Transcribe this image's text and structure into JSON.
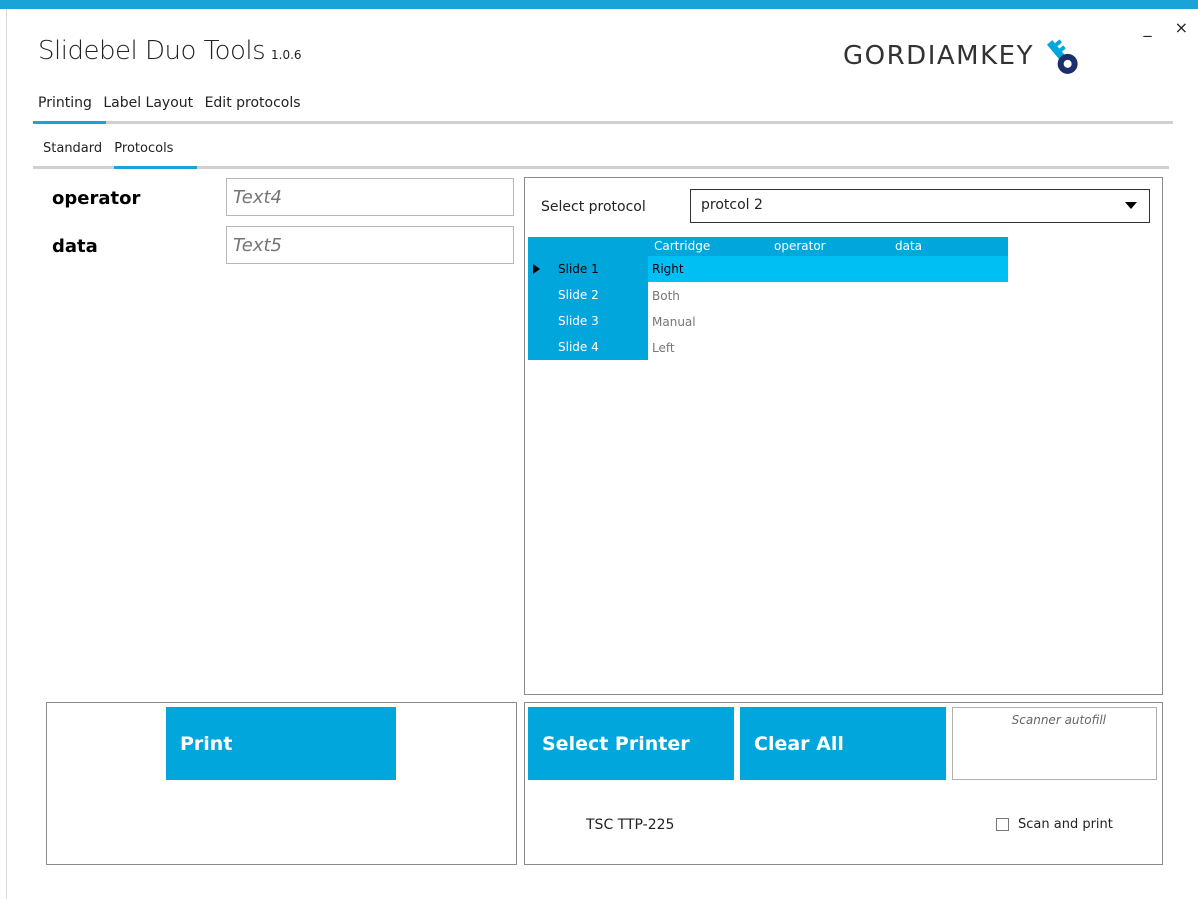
{
  "window": {
    "title": "Slidebel Duo Tools",
    "version": "1.0.6",
    "minimize_label": "_",
    "close_label": "×",
    "logo_text": "GORDIAMKEY",
    "accent_color": "#1aa3d6"
  },
  "main_tabs": [
    {
      "label": "Printing",
      "active": true
    },
    {
      "label": "Label Layout",
      "active": false
    },
    {
      "label": "Edit protocols",
      "active": false
    }
  ],
  "sub_tabs": [
    {
      "label": "Standard",
      "active": false
    },
    {
      "label": "Protocols",
      "active": true
    }
  ],
  "fields": [
    {
      "label": "operator",
      "placeholder": "Text4"
    },
    {
      "label": "data",
      "placeholder": "Text5"
    }
  ],
  "protocol": {
    "select_label": "Select protocol",
    "selected": "protcol 2"
  },
  "grid": {
    "columns": [
      "Cartridge",
      "operator",
      "data"
    ],
    "rows": [
      {
        "header": "Slide 1",
        "cartridge": "Right",
        "selected": true
      },
      {
        "header": "Slide 2",
        "cartridge": "Both",
        "selected": false
      },
      {
        "header": "Slide 3",
        "cartridge": "Manual",
        "selected": false
      },
      {
        "header": "Slide 4",
        "cartridge": "Left",
        "selected": false
      }
    ]
  },
  "buttons": {
    "print": "Print",
    "select_printer": "Select Printer",
    "clear_all": "Clear All"
  },
  "scanner": {
    "placeholder": "Scanner autofill",
    "scan_and_print_label": "Scan and print",
    "scan_and_print_checked": false
  },
  "printer": {
    "name": "TSC TTP-225"
  }
}
